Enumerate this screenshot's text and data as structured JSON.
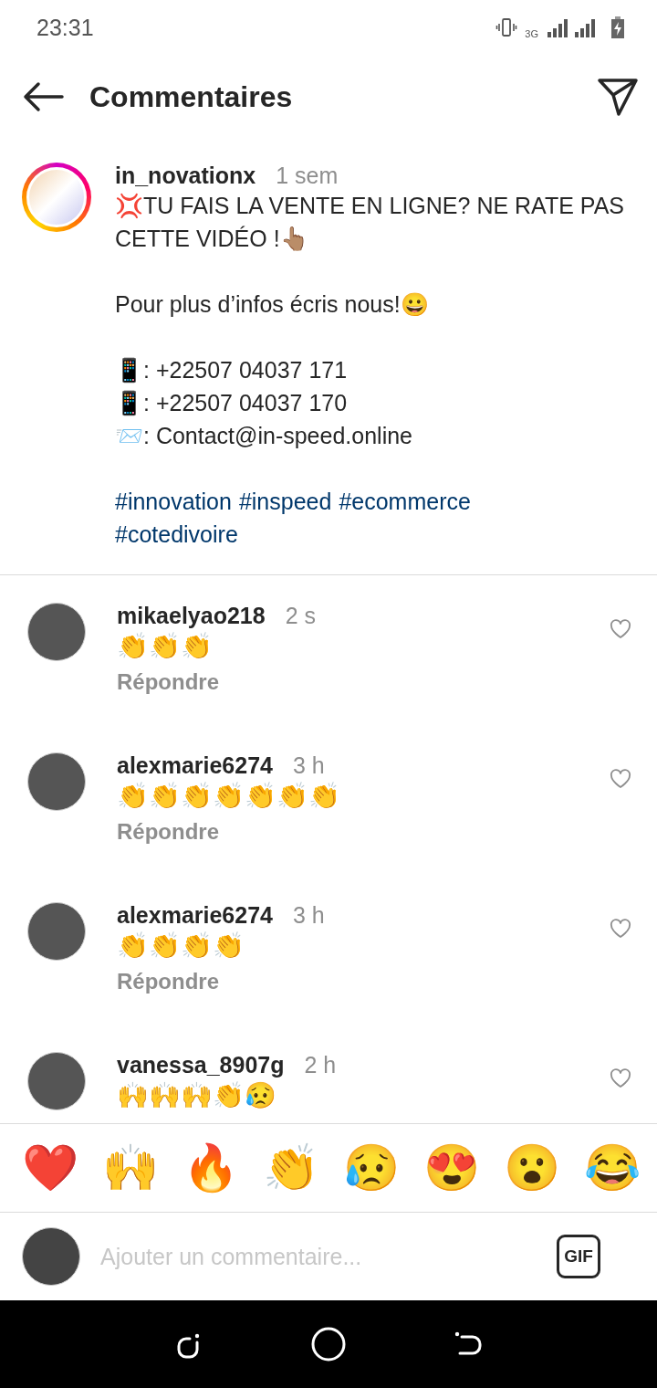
{
  "status_bar": {
    "time": "23:31",
    "network": "3G"
  },
  "header": {
    "title": "Commentaires"
  },
  "post": {
    "username": "in_novationx",
    "time": "1 sem",
    "caption": [
      [
        "💢TU FAIS LA VENTE EN LIGNE? NE RATE PAS CETTE VIDÉO !👆🏽"
      ],
      [
        "Pour plus d’infos écris nous!😀"
      ],
      [
        "📱: +22507 04037 171",
        "📱: +22507 04037 170",
        "📨: Contact@in-speed.online"
      ]
    ],
    "hashtags": [
      "#innovation",
      "#inspeed",
      "#ecommerce",
      "#cotedivoire"
    ]
  },
  "comments": [
    {
      "username": "mikaelyao218",
      "time": "2 s",
      "text": "👏👏👏",
      "reply": "Répondre"
    },
    {
      "username": "alexmarie6274",
      "time": "3 h",
      "text": "👏👏👏👏👏👏👏",
      "reply": "Répondre"
    },
    {
      "username": "alexmarie6274",
      "time": "3 h",
      "text": "👏👏👏👏",
      "reply": "Répondre"
    },
    {
      "username": "vanessa_8907g",
      "time": "2 h",
      "text": "🙌🙌🙌👏😥"
    }
  ],
  "reactions": [
    "❤️",
    "🙌",
    "🔥",
    "👏",
    "😥",
    "😍",
    "😮",
    "😂"
  ],
  "composer": {
    "placeholder": "Ajouter un commentaire...",
    "gif": "GIF"
  }
}
